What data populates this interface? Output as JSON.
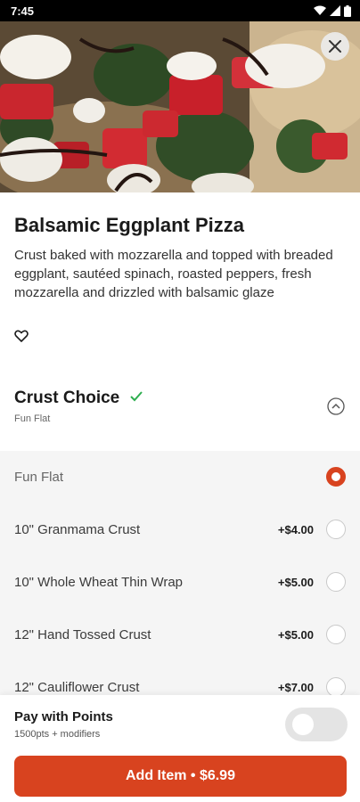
{
  "status_bar": {
    "time": "7:45"
  },
  "hero": {
    "image_alt": "pizza photo"
  },
  "item": {
    "title": "Balsamic Eggplant Pizza",
    "description": "Crust baked with mozzarella and topped with breaded eggplant, sautéed spinach, roasted peppers, fresh mozzarella and drizzled with balsamic glaze"
  },
  "crust_choice": {
    "title": "Crust Choice",
    "selected_summary": "Fun Flat",
    "options": [
      {
        "label": "Fun Flat",
        "price": "",
        "selected": true
      },
      {
        "label": "10\" Granmama Crust",
        "price": "+$4.00",
        "selected": false
      },
      {
        "label": "10\" Whole Wheat Thin Wrap",
        "price": "+$5.00",
        "selected": false
      },
      {
        "label": "12\" Hand Tossed Crust",
        "price": "+$5.00",
        "selected": false
      },
      {
        "label": "12\" Cauliflower Crust",
        "price": "+$7.00",
        "selected": false
      }
    ]
  },
  "points": {
    "title": "Pay with Points",
    "subtitle": "1500pts + modifiers",
    "enabled": false
  },
  "add_button": {
    "label": "Add Item • $6.99"
  },
  "colors": {
    "accent": "#d8431f",
    "check": "#2eae4f"
  }
}
